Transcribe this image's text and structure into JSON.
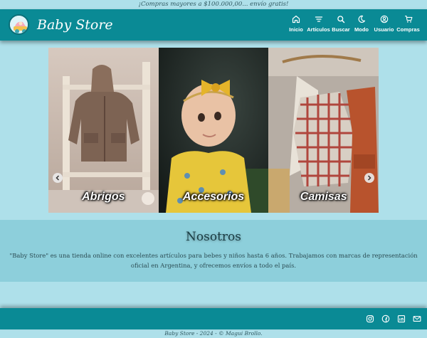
{
  "promo_banner": "¡Compras mayores a $100.000,00... envío gratis!",
  "header": {
    "brand": "Baby Store",
    "nav": [
      {
        "label": "Inicio",
        "icon": "home-icon"
      },
      {
        "label": "Artículos",
        "icon": "filter-icon"
      },
      {
        "label": "Buscar",
        "icon": "search-icon"
      },
      {
        "label": "Modo",
        "icon": "moon-icon"
      },
      {
        "label": "Usuario",
        "icon": "user-icon"
      },
      {
        "label": "Compras",
        "icon": "cart-icon"
      }
    ]
  },
  "carousel": {
    "slides": [
      {
        "label": "Abrigos"
      },
      {
        "label": "Accesorios"
      },
      {
        "label": "Camisas"
      }
    ]
  },
  "about": {
    "title": "Nosotros",
    "text": "\"Baby Store\" es una tienda online con excelentes artículos para bebes y niños hasta 6 años. Trabajamos con marcas de representación oficial en Argentina, y ofrecemos envíos a todo el país."
  },
  "footer": {
    "socials": [
      "instagram-icon",
      "facebook-icon",
      "linkedin-icon",
      "mail-icon"
    ],
    "copyright": "Baby Store - 2024 - © Magui Brollo."
  },
  "colors": {
    "page_bg": "#aee0ea",
    "header_bg": "#0a8a95",
    "about_bg": "#8dcfdb"
  }
}
